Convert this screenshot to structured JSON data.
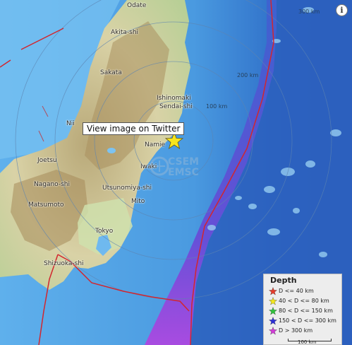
{
  "places": {
    "odate": "Odate",
    "akita": "Akita-shi",
    "sakata": "Sakata",
    "ishinomaki": "Ishinomaki",
    "sendai": "Sendai-shi",
    "niigata": "Nii",
    "namie": "Namie",
    "joetsu": "Joetsu",
    "iwaki": "Iwaki",
    "nagano": "Nagano-shi",
    "utsunomiya": "Utsunomiya-shi",
    "matsumoto": "Matsumoto",
    "tokyo": "Tokyo",
    "shizuoka": "Shizuoka-shi",
    "mito": "Mito"
  },
  "distance_rings": {
    "r100": "100 km",
    "r200": "200 km",
    "r300": "300 km"
  },
  "tooltip": "View image on Twitter",
  "info_button": "i",
  "watermark": {
    "line1": "CSEM",
    "line2": "EMSC"
  },
  "legend": {
    "title": "Depth",
    "rows": [
      {
        "label": "D <= 40 km",
        "color": "#e53a2a"
      },
      {
        "label": "40 < D <= 80 km",
        "color": "#f4e619"
      },
      {
        "label": "80 < D <= 150 km",
        "color": "#2fc23a"
      },
      {
        "label": "150 < D <= 300 km",
        "color": "#2b2fd6"
      },
      {
        "label": "D > 300 km",
        "color": "#d23ad7"
      }
    ],
    "scale": "100 km"
  },
  "epicenter_marker": {
    "color": "#f7e51e"
  }
}
